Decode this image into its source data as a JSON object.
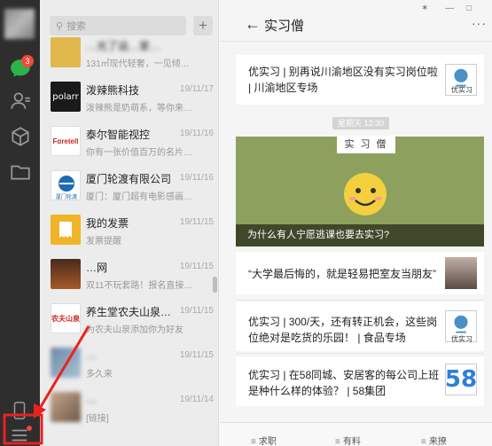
{
  "sidebar": {
    "chat_badge": "3",
    "icons": [
      "chat-icon",
      "contacts-icon",
      "favorites-icon",
      "files-icon",
      "phone-icon",
      "menu-icon"
    ]
  },
  "search": {
    "placeholder": "搜索"
  },
  "chat_list": [
    {
      "name": "…光了运…家…",
      "date": "",
      "snippet": "131㎡现代轻奢，一见倾…"
    },
    {
      "name": "泼辣熊科技",
      "date": "19/11/17",
      "snippet": "泼辣熊是奶萌系，等你来…"
    },
    {
      "name": "泰尔智能视控",
      "date": "19/11/16",
      "snippet": "你有一张价值百万的名片…"
    },
    {
      "name": "厦门轮渡有限公司",
      "date": "19/11/16",
      "snippet": "厦门：厦门超有电影感画…"
    },
    {
      "name": "我的发票",
      "date": "19/11/15",
      "snippet": "发票提醒"
    },
    {
      "name": "…网",
      "date": "19/11/15",
      "snippet": "双11不玩套路！报名直接…"
    },
    {
      "name": "养生堂农夫山泉…",
      "date": "19/11/15",
      "snippet": "为农夫山泉添加你为好友"
    },
    {
      "name": "…",
      "date": "19/11/15",
      "snippet": "多久来"
    },
    {
      "name": "…",
      "date": "19/11/14",
      "snippet": "[链接]"
    }
  ],
  "chat": {
    "title": "实习僧",
    "timestamp": "星期天 12:30",
    "cover_label": "实 习 僧",
    "cover_title": "为什么有人宁愿逃课也要去实习?",
    "articles_before": [
      {
        "text": "优实习 | 别再说川渝地区没有实习岗位啦 | 川渝地区专场",
        "pic_label": "优实习"
      }
    ],
    "articles_after": [
      {
        "text": "“大学最后悔的，就是轻易把室友当朋友”",
        "pic_label": ""
      },
      {
        "text": "优实习 | 300/天，还有转正机会，这些岗位绝对是吃货的乐园！ | 食品专场",
        "pic_label": "优实习"
      },
      {
        "text": "优实习 | 在58同城、安居客的每公司上班是种什么样的体验？ | 58集团",
        "pic_label": "58"
      }
    ]
  },
  "bottom_menu": [
    "求职",
    "有料",
    "来撩"
  ],
  "colors": {
    "rail": "#2e2e2e",
    "badge": "#f2483b",
    "cover": "#8da05e",
    "arrow": "#e8231f"
  }
}
